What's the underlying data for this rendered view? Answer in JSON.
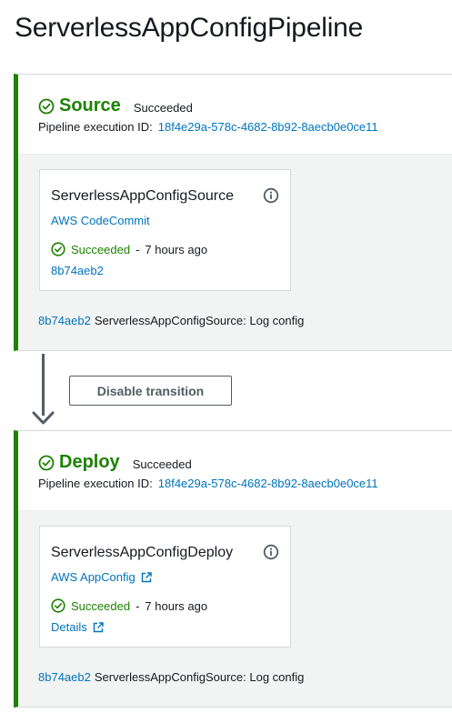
{
  "page": {
    "title": "ServerlessAppConfigPipeline"
  },
  "colors": {
    "success": "#1d8102",
    "link": "#0073bb",
    "stage_border": "#1d8102"
  },
  "stages": [
    {
      "name": "Source",
      "status": "Succeeded",
      "execution_label": "Pipeline execution ID:",
      "execution_id": "18f4e29a-578c-4682-8b92-8aecb0e0ce11",
      "action": {
        "name": "ServerlessAppConfigSource",
        "provider": "AWS CodeCommit",
        "provider_external": false,
        "status": "Succeeded",
        "separator": "-",
        "time": "7 hours ago",
        "bottom_link": "8b74aeb2",
        "bottom_link_external": false
      },
      "commit": {
        "id": "8b74aeb2",
        "message": "ServerlessAppConfigSource: Log config"
      }
    },
    {
      "name": "Deploy",
      "status": "Succeeded",
      "execution_label": "Pipeline execution ID:",
      "execution_id": "18f4e29a-578c-4682-8b92-8aecb0e0ce11",
      "action": {
        "name": "ServerlessAppConfigDeploy",
        "provider": "AWS AppConfig",
        "provider_external": true,
        "status": "Succeeded",
        "separator": "-",
        "time": "7 hours ago",
        "bottom_link": "Details",
        "bottom_link_external": true
      },
      "commit": {
        "id": "8b74aeb2",
        "message": "ServerlessAppConfigSource: Log config"
      }
    }
  ],
  "transition": {
    "button_label": "Disable transition"
  },
  "icons": {
    "stage_status": "check-circle-icon",
    "info": "info-icon",
    "external": "external-link-icon",
    "transition_arrow": "arrow-down-icon"
  }
}
